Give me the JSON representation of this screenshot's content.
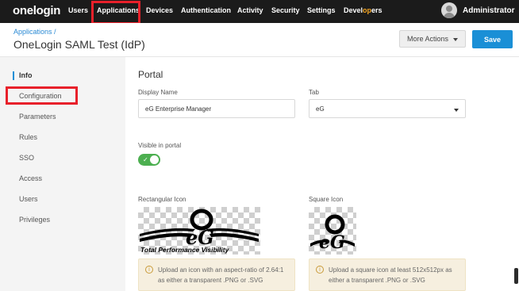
{
  "nav": {
    "logo": "onelogin",
    "items": [
      "Users",
      "Applications",
      "Devices",
      "Authentication",
      "Activity",
      "Security",
      "Settings"
    ],
    "developers_prefix": "Devel",
    "developers_highlight": "op",
    "developers_suffix": "ers",
    "user_name": "Administrator"
  },
  "header": {
    "breadcrumb": "Applications /",
    "title": "OneLogin SAML Test (IdP)",
    "more_actions_label": "More Actions",
    "save_label": "Save"
  },
  "sidebar": {
    "items": [
      "Info",
      "Configuration",
      "Parameters",
      "Rules",
      "SSO",
      "Access",
      "Users",
      "Privileges"
    ],
    "active": "Info"
  },
  "portal": {
    "section_title": "Portal",
    "display_name_label": "Display Name",
    "display_name_value": "eG Enterprise Manager",
    "tab_label": "Tab",
    "tab_value": "eG",
    "visible_label": "Visible in portal",
    "visible_on": true,
    "rect_icon_label": "Rectangular Icon",
    "rect_icon_tagline": "Total Performance Visibility",
    "square_icon_label": "Square Icon",
    "rect_info_text": "Upload an icon with an aspect-ratio of 2.64:1 as either a transparent .PNG or .SVG",
    "square_info_text": "Upload a square icon at least 512x512px as either a transparent .PNG or .SVG"
  },
  "colors": {
    "nav_bg": "#1b1b1b",
    "accent_blue": "#1a8fd6",
    "highlight_red": "#e8202a",
    "toggle_green": "#4caf50",
    "info_bg": "#f6efdf"
  }
}
